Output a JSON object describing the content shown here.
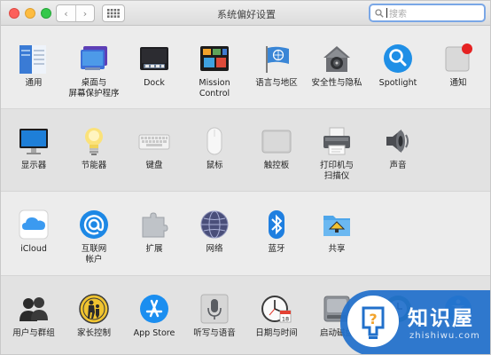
{
  "window": {
    "title": "系统偏好设置",
    "search_placeholder": "搜索",
    "nav_back_glyph": "‹",
    "nav_forward_glyph": "›"
  },
  "colors": {
    "accent": "#2170cb",
    "close": "#fc605b",
    "minimize": "#fdbc40",
    "maximize": "#34c84a",
    "notification_badge": "#e52222"
  },
  "rows": [
    {
      "items": [
        {
          "label": "通用",
          "icon": "general-file-icon"
        },
        {
          "label": "桌面与\n屏幕保护程序",
          "icon": "desktop-screensaver-icon"
        },
        {
          "label": "Dock",
          "icon": "dock-icon"
        },
        {
          "label": "Mission\nControl",
          "icon": "mission-control-icon"
        },
        {
          "label": "语言与地区",
          "icon": "language-flag-icon"
        },
        {
          "label": "安全性与隐私",
          "icon": "security-house-icon"
        },
        {
          "label": "Spotlight",
          "icon": "spotlight-magnifier-icon"
        },
        {
          "label": "通知",
          "icon": "notifications-icon"
        }
      ]
    },
    {
      "items": [
        {
          "label": "显示器",
          "icon": "display-monitor-icon"
        },
        {
          "label": "节能器",
          "icon": "energy-saver-bulb-icon"
        },
        {
          "label": "键盘",
          "icon": "keyboard-icon"
        },
        {
          "label": "鼠标",
          "icon": "mouse-icon"
        },
        {
          "label": "触控板",
          "icon": "trackpad-icon"
        },
        {
          "label": "打印机与\n扫描仪",
          "icon": "printer-icon"
        },
        {
          "label": "声音",
          "icon": "speaker-icon"
        }
      ]
    },
    {
      "items": [
        {
          "label": "iCloud",
          "icon": "icloud-icon"
        },
        {
          "label": "互联网\n帐户",
          "icon": "internet-accounts-at-icon"
        },
        {
          "label": "扩展",
          "icon": "extensions-puzzle-icon"
        },
        {
          "label": "网络",
          "icon": "network-globe-icon"
        },
        {
          "label": "蓝牙",
          "icon": "bluetooth-icon"
        },
        {
          "label": "共享",
          "icon": "sharing-folder-icon"
        }
      ]
    },
    {
      "items": [
        {
          "label": "用户与群组",
          "icon": "users-groups-icon"
        },
        {
          "label": "家长控制",
          "icon": "parental-controls-icon"
        },
        {
          "label": "App Store",
          "icon": "app-store-icon"
        },
        {
          "label": "听写与语音",
          "icon": "dictation-microphone-icon"
        },
        {
          "label": "日期与时间",
          "icon": "date-time-clock-icon"
        },
        {
          "label": "启动磁盘",
          "icon": "startup-disk-icon"
        },
        {
          "label": "",
          "icon": "time-machine-icon"
        },
        {
          "label": "",
          "icon": "accessibility-icon"
        }
      ]
    }
  ],
  "watermark": {
    "brand": "知识屋",
    "domain": "zhishiwu.com",
    "logo_glyph": "?"
  }
}
